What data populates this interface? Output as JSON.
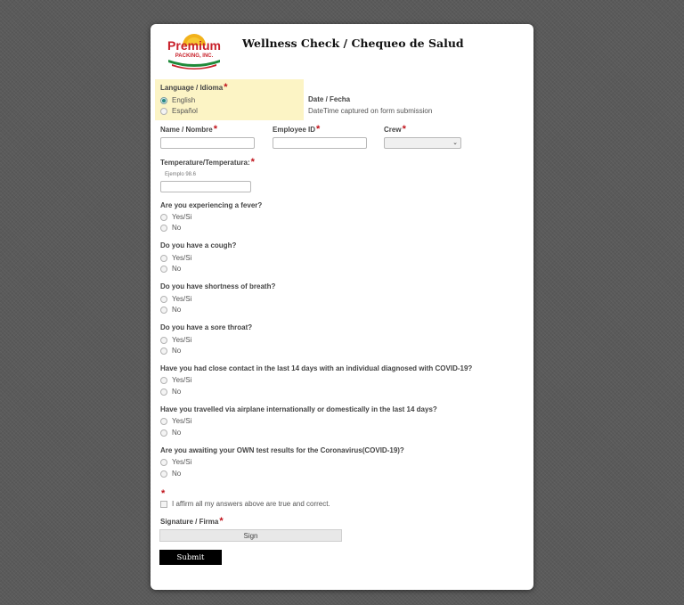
{
  "colors": {
    "required": "#c0121a",
    "language_highlight": "#fcf4c5",
    "submit_bg": "#000000"
  },
  "header": {
    "logo": {
      "brand": "Premium",
      "subtitle": "PACKING, INC."
    },
    "title": "Wellness Check / Chequeo de Salud"
  },
  "language": {
    "label": "Language / Idioma",
    "options": [
      {
        "label": "English",
        "selected": true
      },
      {
        "label": "Español",
        "selected": false
      }
    ]
  },
  "date": {
    "label": "Date / Fecha",
    "value": "DateTime captured on form submission"
  },
  "fields": {
    "name_label": "Name / Nombre",
    "employee_id_label": "Employee ID",
    "crew_label": "Crew",
    "crew_value": "",
    "temperature_label": "Temperature/Temperatura:",
    "temperature_hint": "Ejemplo 98.6"
  },
  "questions": [
    {
      "text": "Are you experiencing a fever?",
      "options": [
        "Yes/Si",
        "No"
      ]
    },
    {
      "text": "Do you have a cough?",
      "options": [
        "Yes/Si",
        "No"
      ]
    },
    {
      "text": "Do you have shortness of breath?",
      "options": [
        "Yes/Si",
        "No"
      ]
    },
    {
      "text": "Do you have a sore throat?",
      "options": [
        "Yes/Si",
        "No"
      ]
    },
    {
      "text": "Have you had close contact in the last 14 days with an individual diagnosed with COVID-19?",
      "options": [
        "Yes/Si",
        "No"
      ]
    },
    {
      "text": "Have you travelled via airplane internationally or domestically in the last 14 days?",
      "options": [
        "Yes/Si",
        "No"
      ]
    },
    {
      "text": "Are you awaiting your OWN test results for the Coronavirus(COVID-19)?",
      "options": [
        "Yes/Si",
        "No"
      ]
    }
  ],
  "affirm": {
    "text": "I affirm all my answers above are true and correct."
  },
  "signature": {
    "label": "Signature / Firma",
    "button": "Sign"
  },
  "submit": {
    "label": "Submit"
  }
}
